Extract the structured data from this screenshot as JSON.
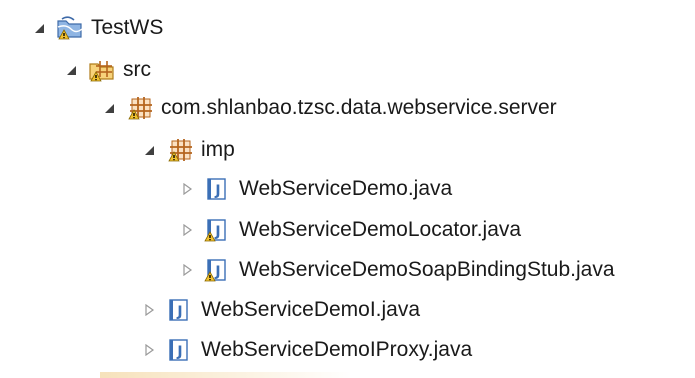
{
  "tree": {
    "project": {
      "label": "TestWS",
      "expanded": true
    },
    "src": {
      "label": "src",
      "expanded": true
    },
    "package": {
      "label": "com.shlanbao.tzsc.data.webservice.server",
      "expanded": true
    },
    "subpackage": {
      "label": "imp",
      "expanded": true
    },
    "imp_files": [
      {
        "label": "WebServiceDemo.java",
        "warning": false
      },
      {
        "label": "WebServiceDemoLocator.java",
        "warning": true
      },
      {
        "label": "WebServiceDemoSoapBindingStub.java",
        "warning": true
      }
    ],
    "package_files": [
      {
        "label": "WebServiceDemoI.java",
        "warning": false
      },
      {
        "label": "WebServiceDemoIProxy.java",
        "warning": false
      }
    ]
  },
  "colors": {
    "java_icon_blue": "#3b6fb6",
    "package_brown": "#b5651d",
    "warning_yellow": "#f2c230",
    "twisty_expanded": "#404040",
    "twisty_collapsed": "#9a9a9a"
  }
}
